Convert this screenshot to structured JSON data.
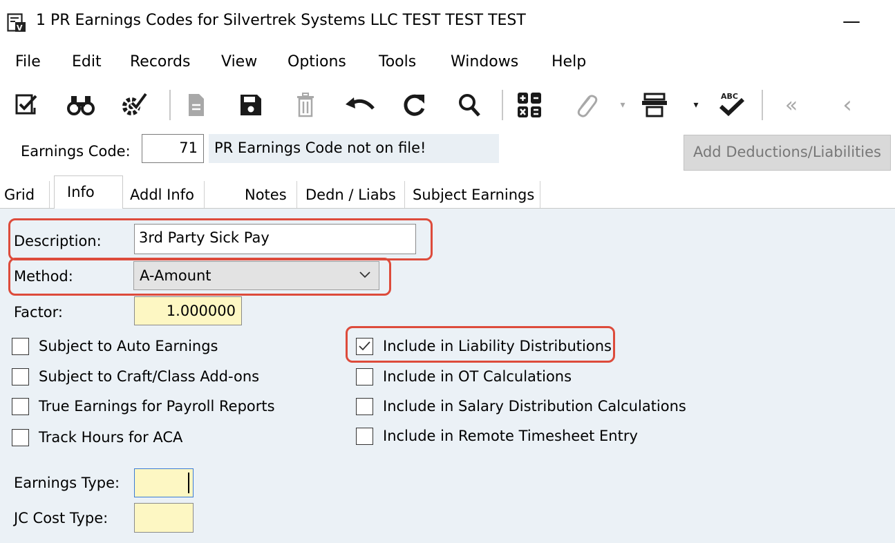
{
  "window": {
    "title": "1 PR Earnings Codes for Silvertrek Systems LLC TEST TEST TEST",
    "minimize": "—"
  },
  "menu": [
    "File",
    "Edit",
    "Records",
    "View",
    "Options",
    "Tools",
    "Windows",
    "Help"
  ],
  "toolbar": {
    "icons": [
      "checklist-icon",
      "binoculars-icon",
      "settings-check-icon",
      "new-document-icon",
      "save-icon",
      "delete-icon",
      "undo-icon",
      "refresh-icon",
      "search-icon",
      "calculator-icon",
      "attachment-icon",
      "print-icon",
      "spellcheck-icon",
      "first-record-icon",
      "previous-record-icon"
    ],
    "spellcheck_text": "ABC",
    "first": "«",
    "previous": "‹",
    "dropdown": "▾"
  },
  "header": {
    "earnings_code_label": "Earnings Code:",
    "earnings_code_value": "71",
    "status_text": "PR Earnings Code not on file!",
    "add_button": "Add Deductions/Liabilities"
  },
  "tabs": [
    "Grid",
    "Info",
    "Addl Info",
    "Notes",
    "Dedn / Liabs",
    "Subject Earnings"
  ],
  "active_tab": "Info",
  "form": {
    "description_label": "Description:",
    "description_value": "3rd Party Sick Pay",
    "method_label": "Method:",
    "method_value": "A-Amount",
    "factor_label": "Factor:",
    "factor_value": "1.000000",
    "earnings_type_label": "Earnings Type:",
    "earnings_type_value": "",
    "jc_cost_type_label": "JC Cost Type:",
    "jc_cost_type_value": ""
  },
  "checkboxes_left": [
    {
      "label": "Subject to Auto Earnings",
      "checked": false
    },
    {
      "label": "Subject to Craft/Class Add-ons",
      "checked": false
    },
    {
      "label": "True Earnings for Payroll Reports",
      "checked": false
    },
    {
      "label": "Track Hours for ACA",
      "checked": false
    }
  ],
  "checkboxes_right": [
    {
      "label": "Include in Liability Distributions",
      "checked": true
    },
    {
      "label": "Include in OT Calculations",
      "checked": false
    },
    {
      "label": "Include in Salary Distribution Calculations",
      "checked": false
    },
    {
      "label": "Include in Remote Timesheet Entry",
      "checked": false
    }
  ],
  "colors": {
    "highlight": "#dd4b3b",
    "panel": "#ebf1f6",
    "required_field": "#fdf7c3",
    "disabled_button": "#d9d9d9"
  }
}
